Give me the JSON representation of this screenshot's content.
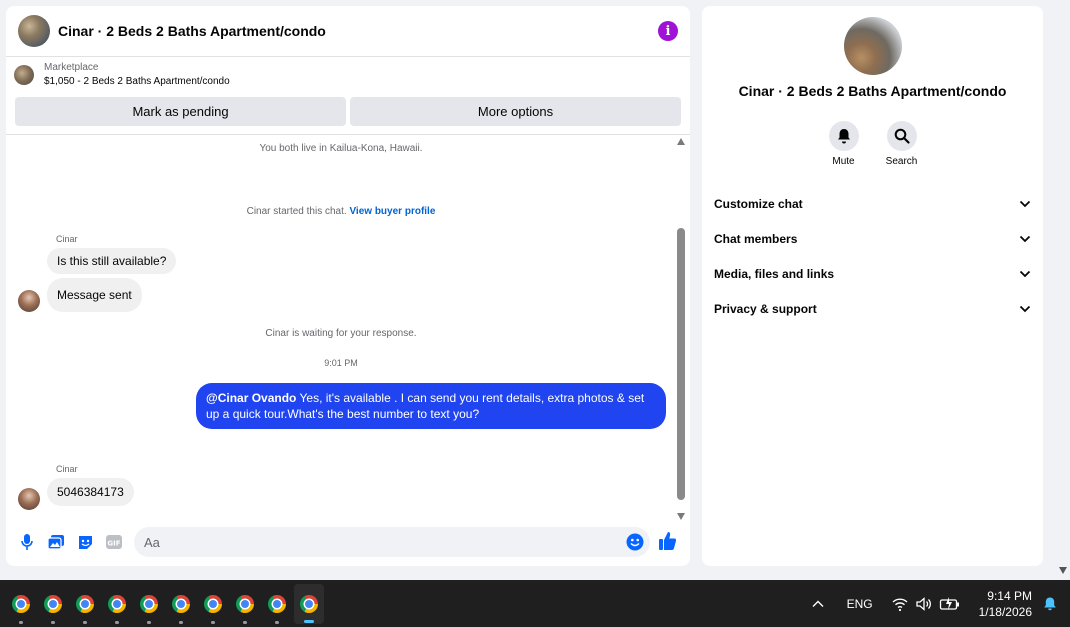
{
  "chat": {
    "title": "Cinar · 2 Beds 2 Baths Apartment/condo",
    "listing_label": "Marketplace",
    "listing_desc": "$1,050 - 2 Beds 2 Baths Apartment/condo",
    "mark_pending_label": "Mark as pending",
    "more_options_label": "More options",
    "location_note": "You both live in Kailua-Kona, Hawaii.",
    "started_note": "Cinar started this chat.",
    "view_profile_link": "View buyer profile",
    "sender_1": "Cinar",
    "msg_1": "Is this still available?",
    "msg_2": "Message sent",
    "waiting_note": "Cinar is waiting for your response.",
    "timestamp": "9:01 PM",
    "outgoing_mention": "@Cinar Ovando",
    "outgoing_text": " Yes, it's available .  I can send you rent details, extra photos & set up a quick tour.What's the best number to text you?",
    "sender_2": "Cinar",
    "msg_3": "5046384173",
    "input_placeholder": "Aa"
  },
  "info": {
    "title": "Cinar · 2 Beds 2 Baths Apartment/condo",
    "mute_label": "Mute",
    "search_label": "Search",
    "sections": [
      "Customize chat",
      "Chat members",
      "Media, files and links",
      "Privacy & support"
    ]
  },
  "taskbar": {
    "language": "ENG",
    "time": "9:14 PM",
    "date": "1/18/2026"
  },
  "colors": {
    "accent": "#1f44f0",
    "info_icon": "#a012d6",
    "link": "#0064d1"
  }
}
